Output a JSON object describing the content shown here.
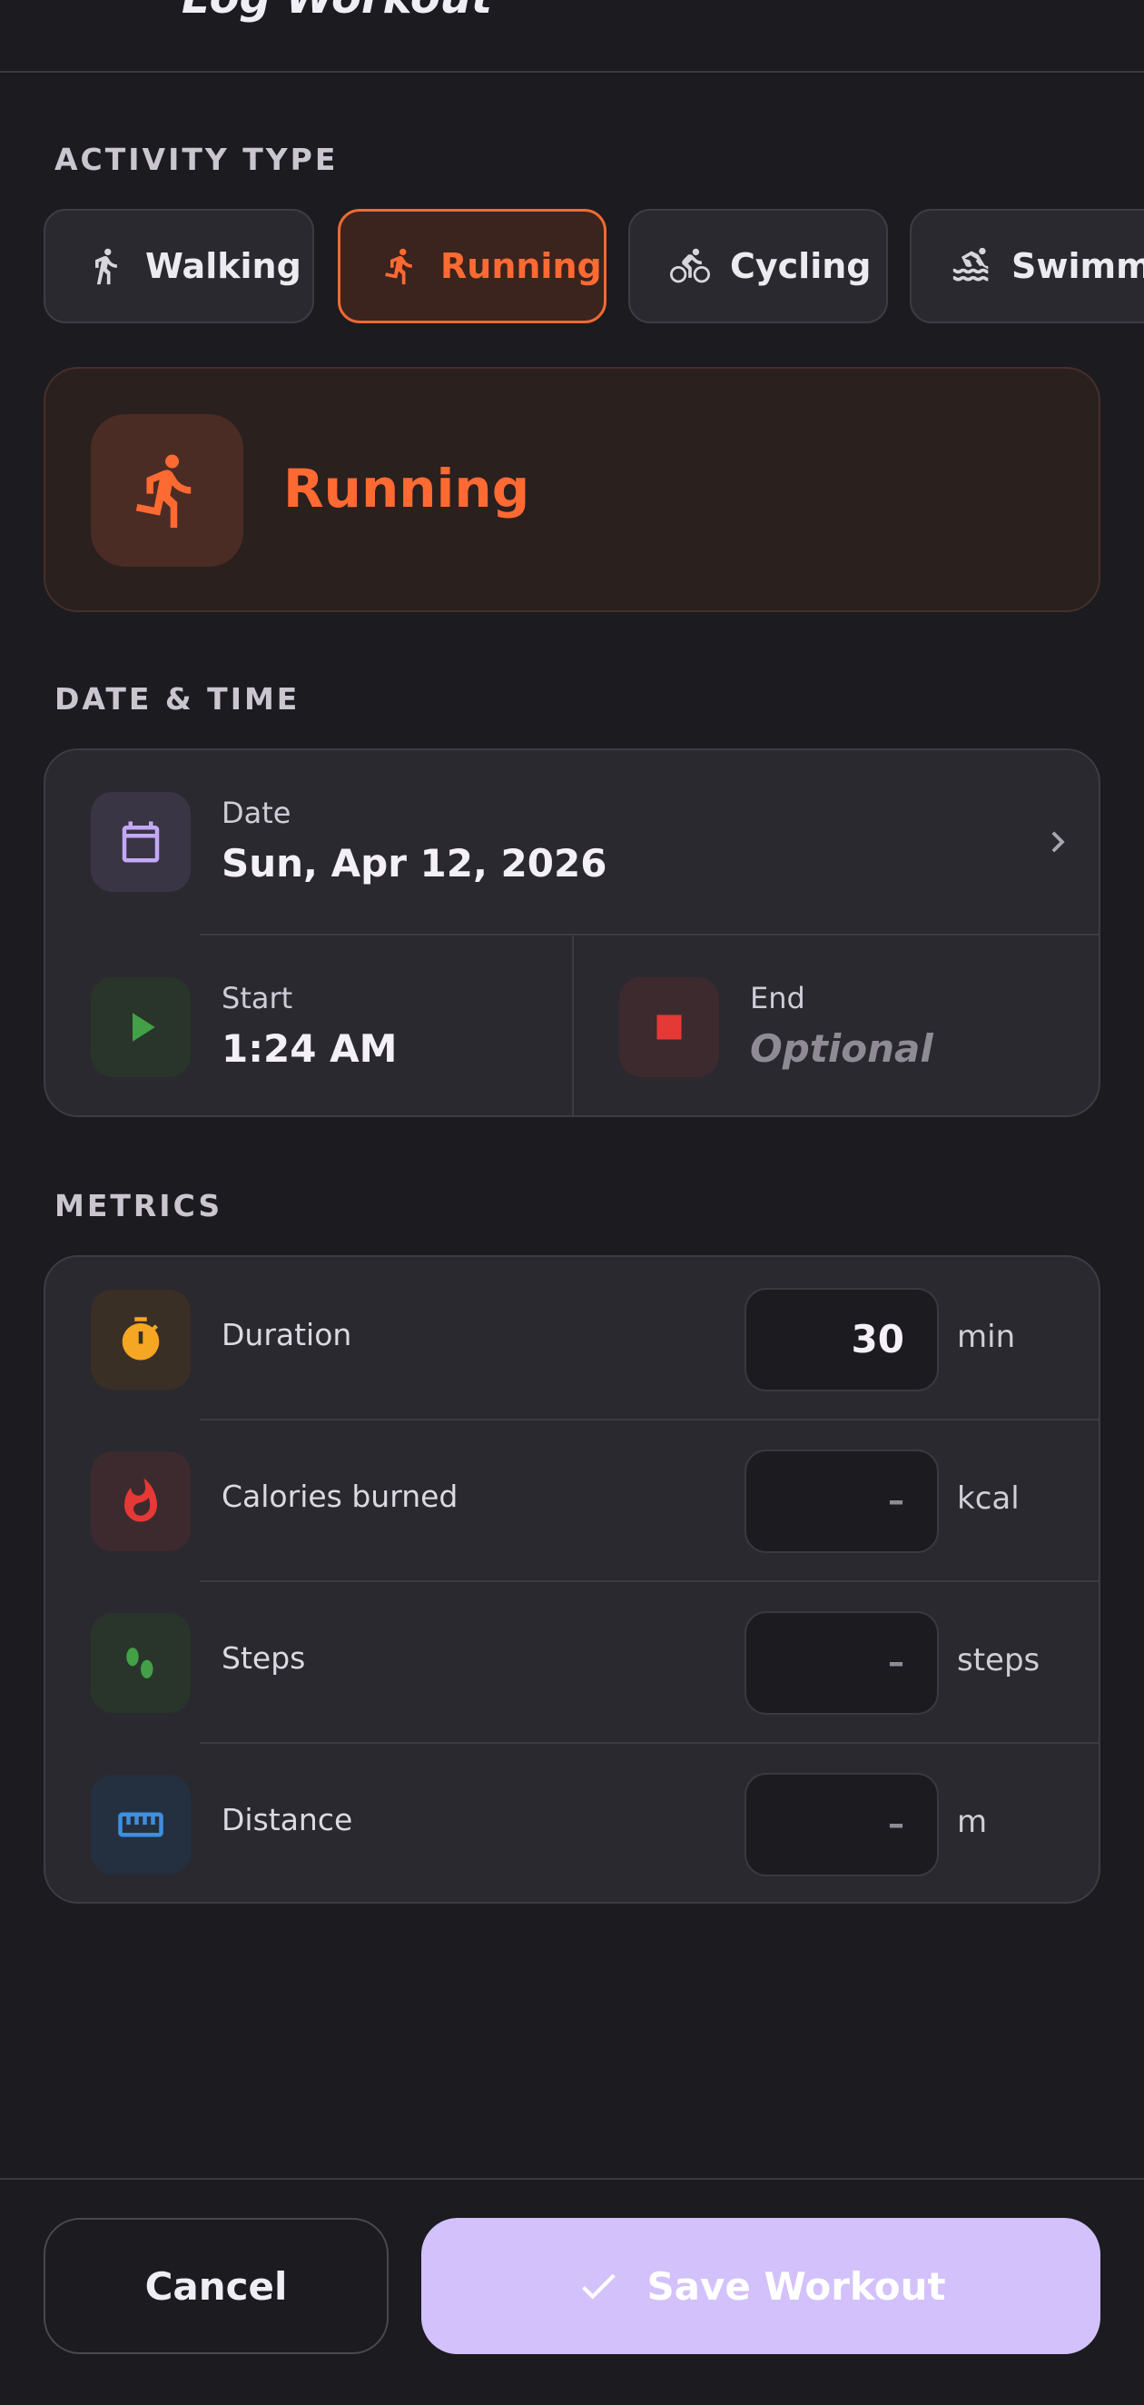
{
  "header": {
    "title": "Log Workout"
  },
  "activity_section": {
    "title": "ACTIVITY TYPE",
    "chips": [
      {
        "label": "Walking",
        "icon": "walking-icon",
        "selected": false
      },
      {
        "label": "Running",
        "icon": "running-icon",
        "selected": true
      },
      {
        "label": "Cycling",
        "icon": "cycling-icon",
        "selected": false
      },
      {
        "label": "Swimming",
        "icon": "swimming-icon",
        "selected": false
      }
    ],
    "selected_label": "Running"
  },
  "datetime_section": {
    "title": "DATE & TIME",
    "date": {
      "label": "Date",
      "value": "Sun, Apr 12, 2026"
    },
    "start": {
      "label": "Start",
      "value": "1:24 AM"
    },
    "end": {
      "label": "End",
      "value": "Optional"
    }
  },
  "metrics_section": {
    "title": "METRICS",
    "rows": [
      {
        "label": "Duration",
        "value": "30",
        "unit": "min",
        "icon": "stopwatch-icon"
      },
      {
        "label": "Calories burned",
        "value": "–",
        "unit": "kcal",
        "icon": "flame-icon"
      },
      {
        "label": "Steps",
        "value": "–",
        "unit": "steps",
        "icon": "footprints-icon"
      },
      {
        "label": "Distance",
        "value": "–",
        "unit": "m",
        "icon": "ruler-icon"
      }
    ]
  },
  "actions": {
    "cancel": "Cancel",
    "save": "Save Workout"
  },
  "colors": {
    "accent_running": "#ff6a33",
    "save_button": "#d3c1fb",
    "start_green": "#43a047",
    "end_red": "#e53935",
    "calendar_purple": "#c3a9f5"
  }
}
